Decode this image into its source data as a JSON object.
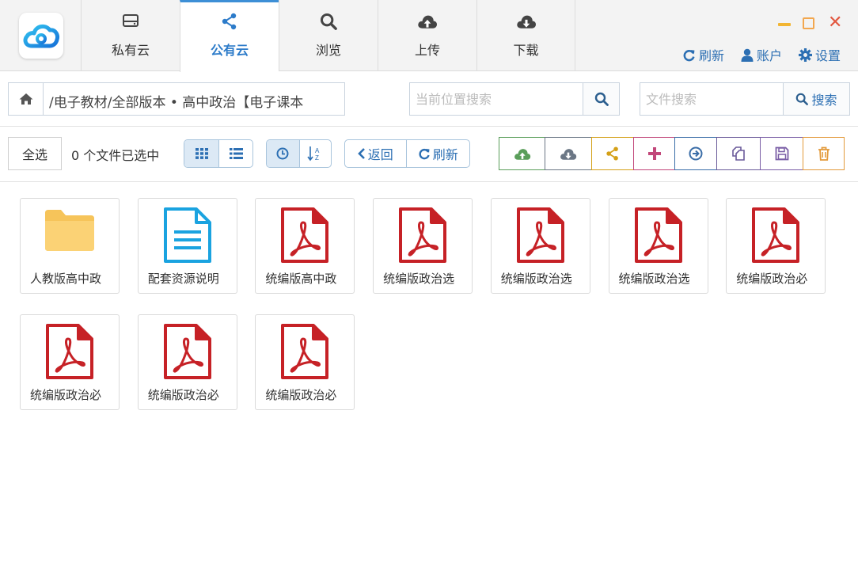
{
  "app": {
    "logo_icon": "cloud-logo-icon"
  },
  "nav": {
    "tabs": [
      {
        "label": "私有云",
        "icon": "hard-drive-icon",
        "active": false
      },
      {
        "label": "公有云",
        "icon": "share-icon",
        "active": true
      },
      {
        "label": "浏览",
        "icon": "search-icon",
        "active": false
      },
      {
        "label": "上传",
        "icon": "cloud-upload-icon",
        "active": false
      },
      {
        "label": "下载",
        "icon": "cloud-download-icon",
        "active": false
      }
    ]
  },
  "header": {
    "refresh_label": "刷新",
    "account_label": "账户",
    "settings_label": "设置"
  },
  "path": {
    "text": "/电子教材/全部版本 • 高中政治【电子课本"
  },
  "search": {
    "location_placeholder": "当前位置搜索",
    "file_placeholder": "文件搜索",
    "file_button_label": "搜索"
  },
  "toolbar": {
    "select_all_label": "全选",
    "selected_count_text": "0 个文件已选中",
    "back_label": "返回",
    "refresh_label": "刷新",
    "view_mode": "grid",
    "actions": [
      {
        "icon": "cloud-upload-icon",
        "color": "#5a9e5a"
      },
      {
        "icon": "cloud-download-icon",
        "color": "#6b7785"
      },
      {
        "icon": "share-icon",
        "color": "#d4a017"
      },
      {
        "icon": "plus-icon",
        "color": "#c2477a"
      },
      {
        "icon": "arrow-circle-right-icon",
        "color": "#3b6ea8"
      },
      {
        "icon": "copy-icon",
        "color": "#6a5a9a"
      },
      {
        "icon": "save-icon",
        "color": "#7a5ea6"
      },
      {
        "icon": "trash-icon",
        "color": "#e39a3b"
      }
    ]
  },
  "files": [
    {
      "name": "人教版高中政",
      "type": "folder"
    },
    {
      "name": "配套资源说明",
      "type": "doc"
    },
    {
      "name": "统编版高中政",
      "type": "pdf"
    },
    {
      "name": "统编版政治选",
      "type": "pdf"
    },
    {
      "name": "统编版政治选",
      "type": "pdf"
    },
    {
      "name": "统编版政治选",
      "type": "pdf"
    },
    {
      "name": "统编版政治必",
      "type": "pdf"
    },
    {
      "name": "统编版政治必",
      "type": "pdf"
    },
    {
      "name": "统编版政治必",
      "type": "pdf"
    },
    {
      "name": "统编版政治必",
      "type": "pdf"
    }
  ],
  "colors": {
    "accent": "#2c7bc9",
    "pdf": "#c62126",
    "folder": "#f7c75c",
    "doc": "#1aa3e0"
  }
}
